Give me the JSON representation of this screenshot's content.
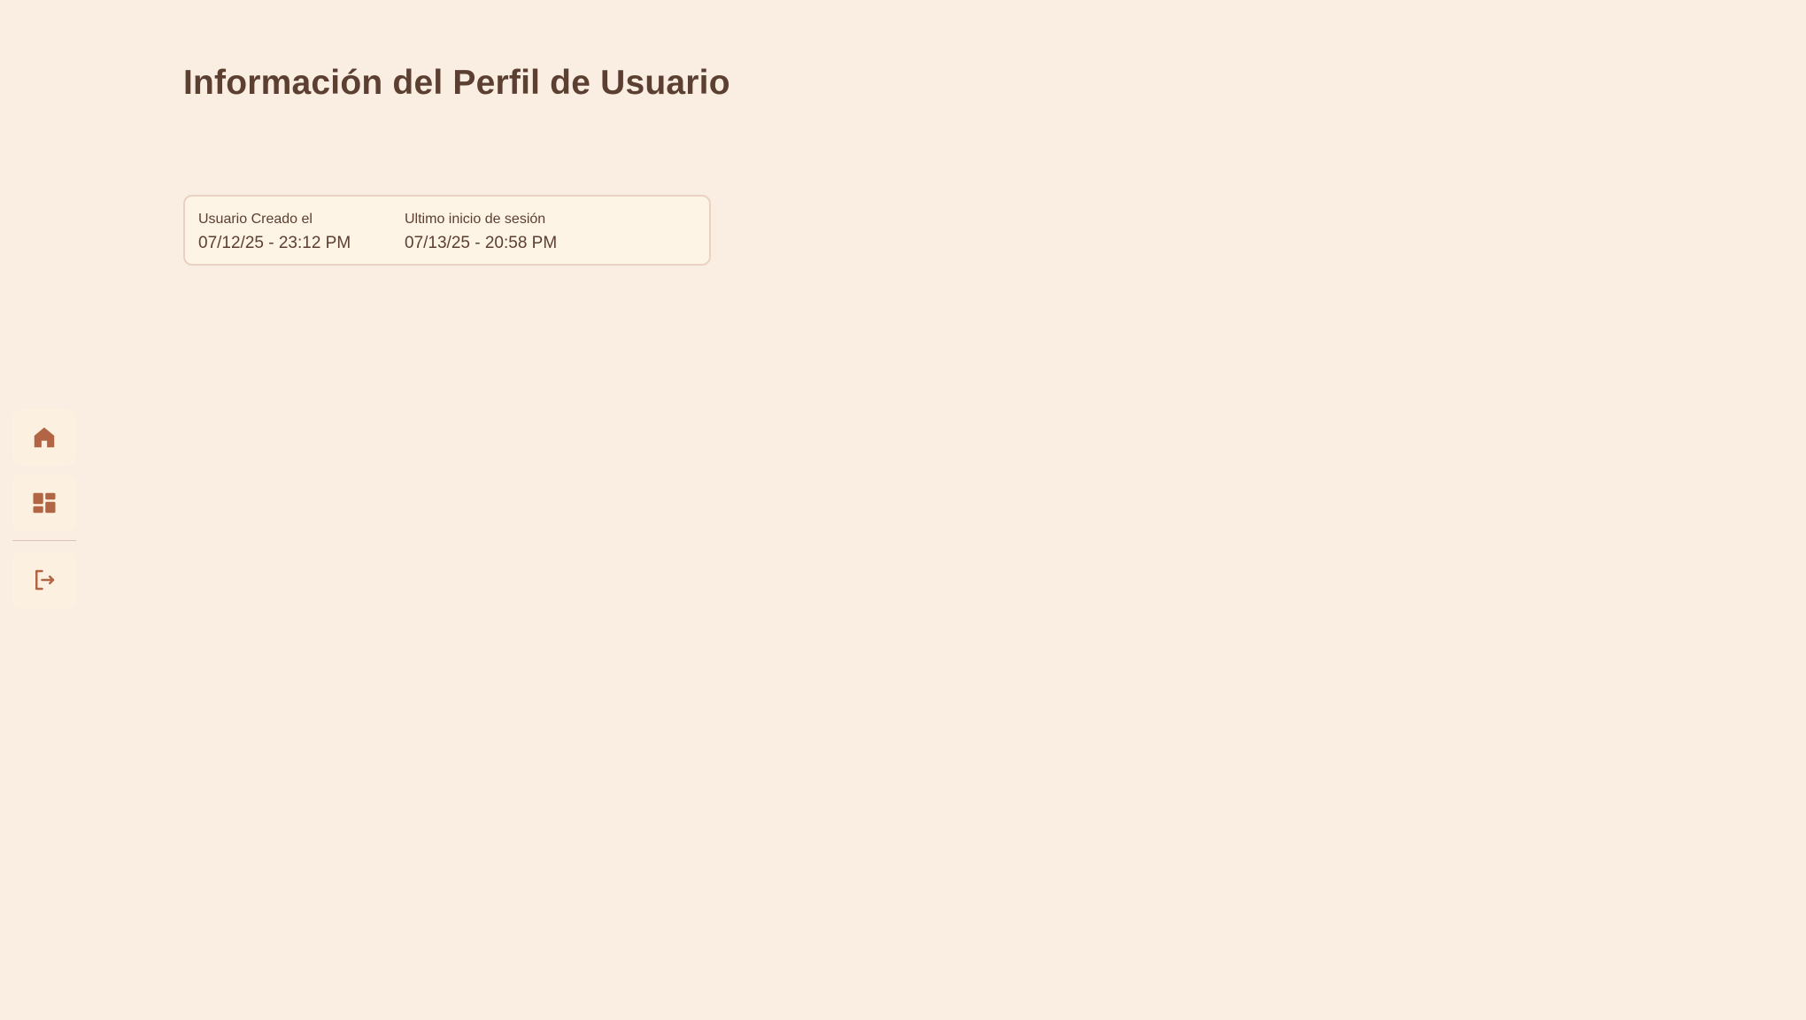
{
  "page": {
    "title": "Información del Perfil de Usuario"
  },
  "sidebar": {
    "items": [
      {
        "icon": "home-icon"
      },
      {
        "icon": "dashboard-icon"
      },
      {
        "icon": "logout-icon"
      }
    ]
  },
  "profile_info": {
    "created": {
      "label": "Usuario Creado el",
      "value": "07/12/25 - 23:12 PM"
    },
    "last_login": {
      "label": "Ultimo inicio de sesión",
      "value": "07/13/25 - 20:58 PM"
    }
  },
  "colors": {
    "background": "#faeee2",
    "text": "#5b3f31",
    "icon_accent": "#b26545",
    "card_background": "#fdf4e6",
    "card_border": "#e9d2c3"
  }
}
